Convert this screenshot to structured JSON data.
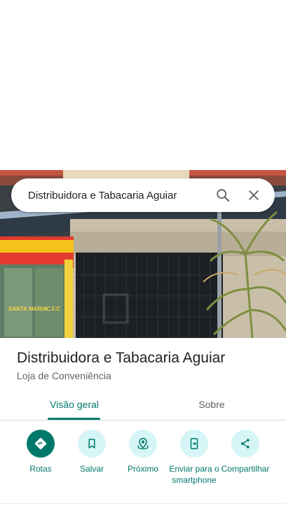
{
  "search": {
    "query": "Distribuidora e Tabacaria Aguiar"
  },
  "place": {
    "name": "Distribuidora e Tabacaria Aguiar",
    "category": "Loja de Conveniência",
    "photo_sign_text": [
      "SANTA MARIA",
      "C.F.C"
    ]
  },
  "tabs": [
    {
      "label": "Visão geral",
      "active": true
    },
    {
      "label": "Sobre",
      "active": false
    }
  ],
  "actions": [
    {
      "label": "Rotas",
      "icon": "directions-icon"
    },
    {
      "label": "Salvar",
      "icon": "bookmark-icon"
    },
    {
      "label": "Próximo",
      "icon": "nearby-icon"
    },
    {
      "label": "Enviar para o smartphone",
      "icon": "send-to-phone-icon"
    },
    {
      "label": "Compartilhar",
      "icon": "share-icon"
    }
  ],
  "colors": {
    "accent": "#00796b",
    "action_circle": "#d6f5f7",
    "secondary_text": "#5f6368"
  }
}
